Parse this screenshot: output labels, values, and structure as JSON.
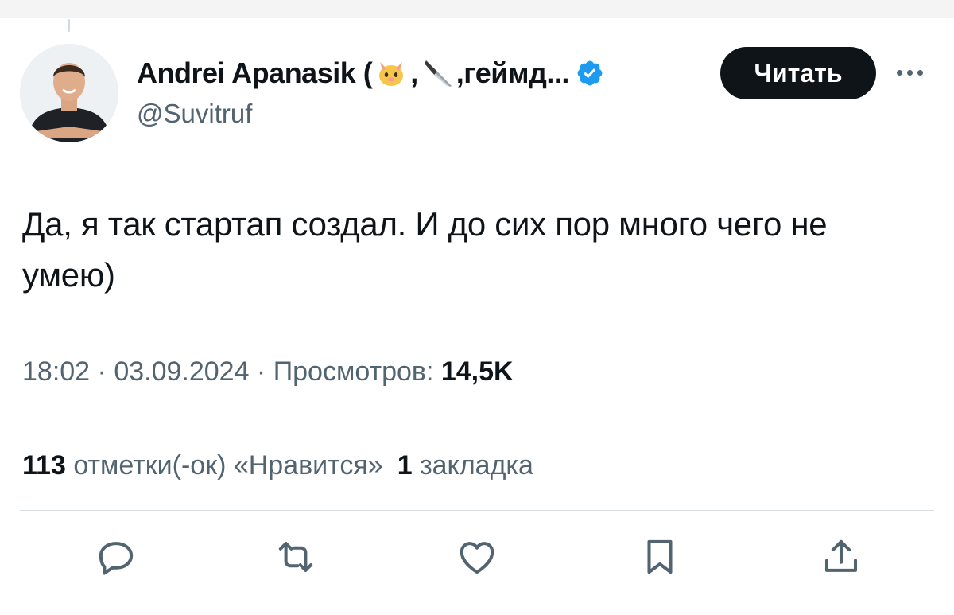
{
  "author": {
    "display_name_prefix": "Andrei Apanasik (",
    "display_name_sep": ",",
    "display_name_suffix": ",геймд...",
    "emoji_1": "cat-face-icon",
    "emoji_2": "kitchen-knife-icon",
    "verified": true,
    "handle": "@Suvitruf"
  },
  "follow_button_label": "Читать",
  "tweet": {
    "text": "Да, я так стартап создал. И до сих пор много чего не умею)"
  },
  "meta": {
    "time": "18:02",
    "separator": " · ",
    "date": "03.09.2024",
    "views_label": "Просмотров: ",
    "views_count": "14,5K"
  },
  "stats": {
    "likes_count": "113",
    "likes_label": "отметки(-ок) «Нравится»",
    "bookmarks_count": "1",
    "bookmarks_label": "закладка"
  },
  "actions": [
    "reply-icon",
    "retweet-icon",
    "like-icon",
    "bookmark-icon",
    "share-icon"
  ],
  "colors": {
    "text_primary": "#0f1419",
    "text_secondary": "#536471",
    "verified_blue": "#1d9bf0",
    "button_bg": "#0f1419",
    "divider": "#d8dee3"
  }
}
